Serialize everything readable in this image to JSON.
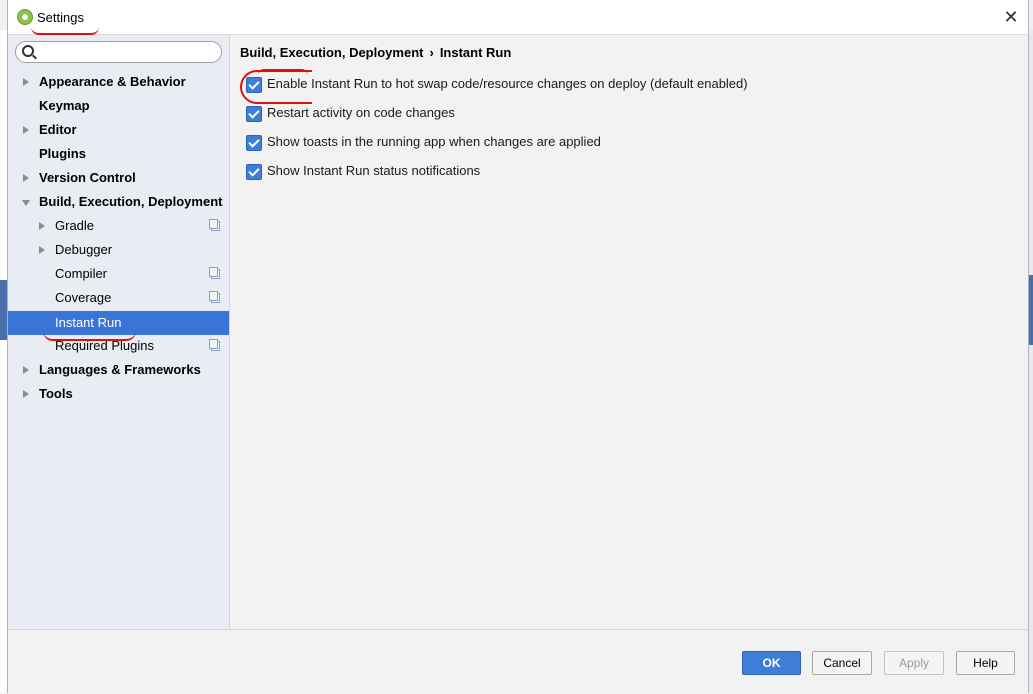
{
  "window": {
    "title": "Settings"
  },
  "search": {
    "placeholder": ""
  },
  "sidebar": {
    "items": [
      {
        "label": "Appearance & Behavior",
        "level": 0,
        "expandable": true,
        "expanded": false
      },
      {
        "label": "Keymap",
        "level": 0,
        "expandable": false
      },
      {
        "label": "Editor",
        "level": 0,
        "expandable": true,
        "expanded": false
      },
      {
        "label": "Plugins",
        "level": 0,
        "expandable": false
      },
      {
        "label": "Version Control",
        "level": 0,
        "expandable": true,
        "expanded": false
      },
      {
        "label": "Build, Execution, Deployment",
        "level": 0,
        "expandable": true,
        "expanded": true
      },
      {
        "label": "Gradle",
        "level": 1,
        "expandable": true,
        "project_icon": true
      },
      {
        "label": "Debugger",
        "level": 1,
        "expandable": true
      },
      {
        "label": "Compiler",
        "level": 1,
        "project_icon": true
      },
      {
        "label": "Coverage",
        "level": 1,
        "project_icon": true
      },
      {
        "label": "Instant Run",
        "level": 1,
        "selected": true
      },
      {
        "label": "Required Plugins",
        "level": 1,
        "project_icon": true
      },
      {
        "label": "Languages & Frameworks",
        "level": 0,
        "expandable": true,
        "expanded": false
      },
      {
        "label": "Tools",
        "level": 0,
        "expandable": true,
        "expanded": false
      }
    ]
  },
  "breadcrumb": {
    "parent": "Build, Execution, Deployment",
    "separator": "›",
    "current": "Instant Run"
  },
  "options": [
    {
      "label": "Enable Instant Run to hot swap code/resource changes on deploy (default enabled)",
      "checked": true
    },
    {
      "label": "Restart activity on code changes",
      "checked": true
    },
    {
      "label": "Show toasts in the running app when changes are applied",
      "checked": true
    },
    {
      "label": "Show Instant Run status notifications",
      "checked": true
    }
  ],
  "buttons": {
    "ok": "OK",
    "cancel": "Cancel",
    "apply": "Apply",
    "help": "Help"
  },
  "colors": {
    "accent": "#3875d7",
    "annotation": "#e01010"
  }
}
